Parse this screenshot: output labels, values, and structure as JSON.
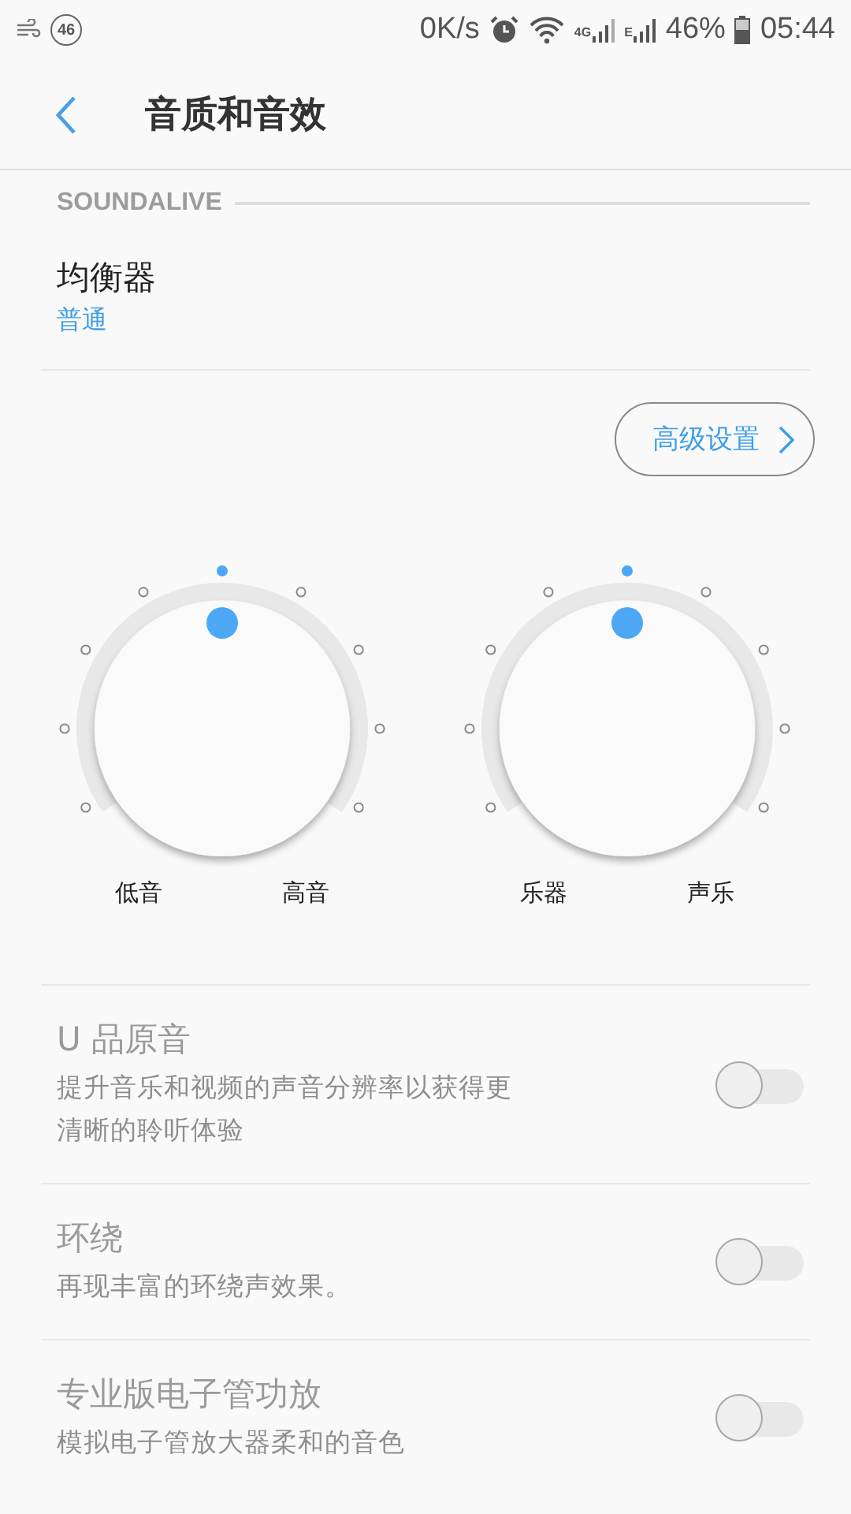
{
  "status_bar": {
    "badge": "46",
    "speed": "0K/s",
    "network_4g": "4G",
    "network_e": "E",
    "battery": "46%",
    "time": "05:44"
  },
  "header": {
    "title": "音质和音效"
  },
  "section": {
    "title": "SOUNDALIVE"
  },
  "equalizer": {
    "title": "均衡器",
    "value": "普通"
  },
  "advanced_button": {
    "label": "高级设置"
  },
  "knobs": [
    {
      "left_label": "低音",
      "right_label": "高音"
    },
    {
      "left_label": "乐器",
      "right_label": "声乐"
    }
  ],
  "settings": [
    {
      "title": "U 品原音",
      "description": "提升音乐和视频的声音分辨率以获得更清晰的聆听体验",
      "on": false,
      "disabled": true
    },
    {
      "title": "环绕",
      "description": "再现丰富的环绕声效果。",
      "on": false,
      "disabled": true
    },
    {
      "title": "专业版电子管功放",
      "description": "模拟电子管放大器柔和的音色",
      "on": false,
      "disabled": true
    }
  ]
}
